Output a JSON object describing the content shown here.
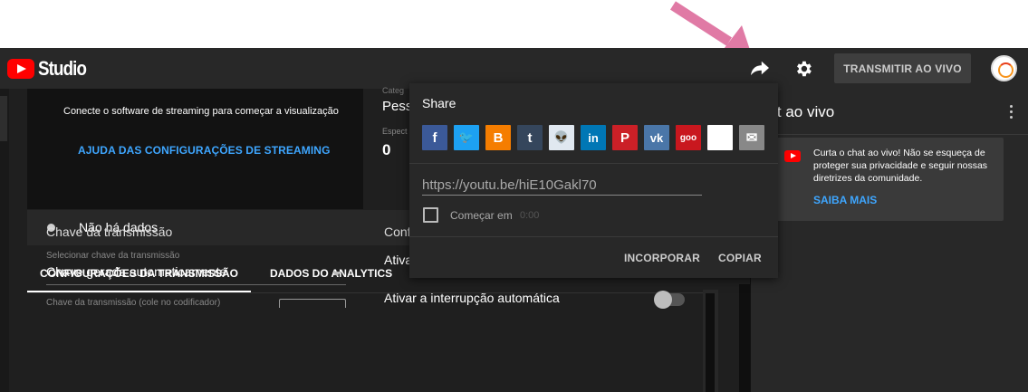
{
  "colors": {
    "accent_blue": "#3ea6ff",
    "brand_red": "#ff0000",
    "header_bg": "#282828",
    "annotation_arrow": "#e07aa5"
  },
  "header": {
    "logo_text": "Studio",
    "icons": [
      "share-icon",
      "gear-icon"
    ],
    "go_live_label": "TRANSMITIR AO VIVO"
  },
  "preview": {
    "message": "Conecte o software de streaming para começar a visualização",
    "help_link": "AJUDA DAS CONFIGURAÇÕES DE STREAMING"
  },
  "stats": {
    "category_value": "Pess",
    "category_label_partial": "Categ",
    "viewers_label_partial": "Espect",
    "viewers_value": "0"
  },
  "status": {
    "text": "Não há dados"
  },
  "tabs": [
    {
      "label": "CONFIGURAÇÕES DA TRANSMISSÃO",
      "active": true
    },
    {
      "label": "DADOS DO ANALYTICS",
      "active": false
    }
  ],
  "stream_key": {
    "section_title": "Chave da transmissão",
    "select_label": "Selecionar chave da transmissão",
    "select_value": "Chave gerada automaticamente",
    "key_label": "Chave da transmissão (cole no codificador)"
  },
  "additional": {
    "section_title": "Configurações adicionais",
    "option_1": "Ativar o início automático",
    "option_2": "Ativar a interrupção automática"
  },
  "chat": {
    "title": "hat ao vivo",
    "message": "Curta o chat ao vivo! Não se esqueça de proteger sua privacidade e seguir nossas diretrizes da comunidade.",
    "link": "SAIBA MAIS"
  },
  "share": {
    "title": "Share",
    "targets": [
      {
        "name": "facebook-icon",
        "glyph": "f",
        "color": "#3b5998"
      },
      {
        "name": "twitter-icon",
        "glyph": "🐦",
        "color": "#1da1f2"
      },
      {
        "name": "blogger-icon",
        "glyph": "B",
        "color": "#f57d00"
      },
      {
        "name": "tumblr-icon",
        "glyph": "t",
        "color": "#35465c"
      },
      {
        "name": "reddit-icon",
        "glyph": "👽",
        "color": "#e0e8f0"
      },
      {
        "name": "linkedin-icon",
        "glyph": "in",
        "color": "#0077b5"
      },
      {
        "name": "pinterest-icon",
        "glyph": "P",
        "color": "#cb2027"
      },
      {
        "name": "vk-icon",
        "glyph": "vk",
        "color": "#4a76a8"
      },
      {
        "name": "goo-icon",
        "glyph": "goo",
        "color": "#c9171e"
      },
      {
        "name": "blank-share-icon",
        "glyph": "",
        "color": "#ffffff"
      },
      {
        "name": "email-icon",
        "glyph": "✉",
        "color": "#888888"
      }
    ],
    "url": "https://youtu.be/hiE10Gakl70",
    "start_label": "Começar em",
    "start_time": "0:00",
    "embed_label": "INCORPORAR",
    "copy_label": "COPIAR"
  }
}
